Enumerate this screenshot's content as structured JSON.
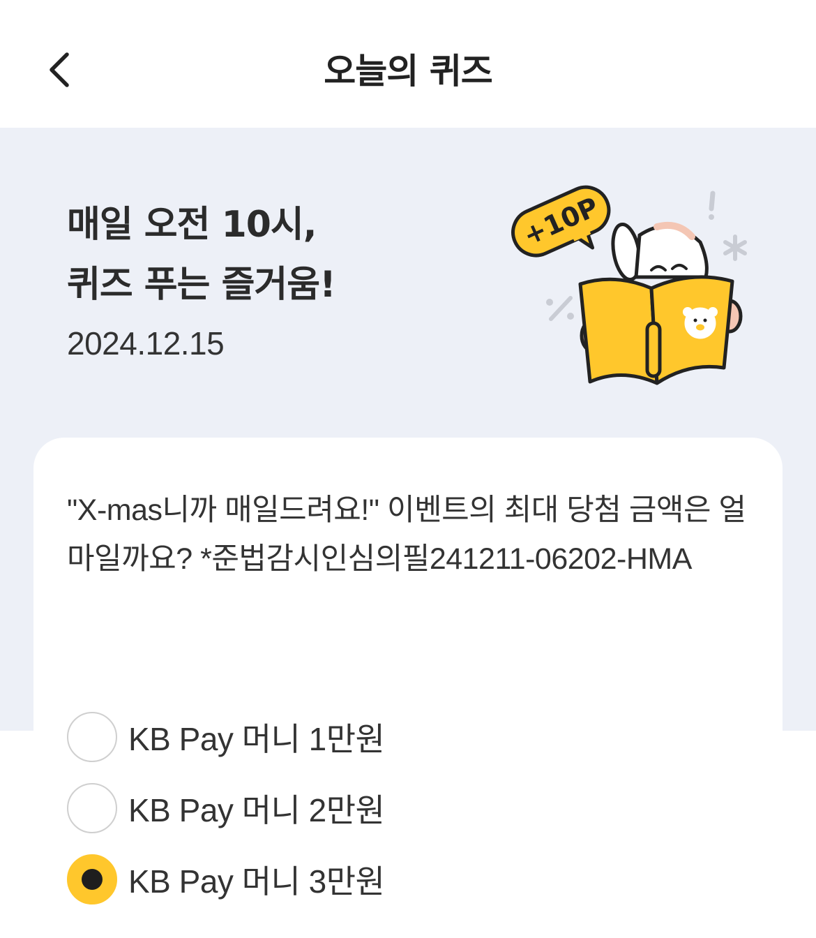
{
  "header": {
    "title": "오늘의 퀴즈",
    "back_icon": "chevron-left-icon"
  },
  "hero": {
    "title_line1": "매일 오전 10시,",
    "title_line2": "퀴즈 푸는 즐거움!",
    "date": "2024.12.15",
    "badge": "+10P",
    "accent_color": "#ffc72c",
    "background_color": "#edf0f7"
  },
  "quiz": {
    "question": "\"X-mas니까 매일드려요!\" 이벤트의 최대 당첨 금액은 얼마일까요? *준법감시인심의필241211-06202-HMA",
    "options": [
      {
        "label": "KB Pay 머니 1만원",
        "selected": false
      },
      {
        "label": "KB Pay 머니 2만원",
        "selected": false
      },
      {
        "label": "KB Pay 머니 3만원",
        "selected": true
      }
    ]
  }
}
